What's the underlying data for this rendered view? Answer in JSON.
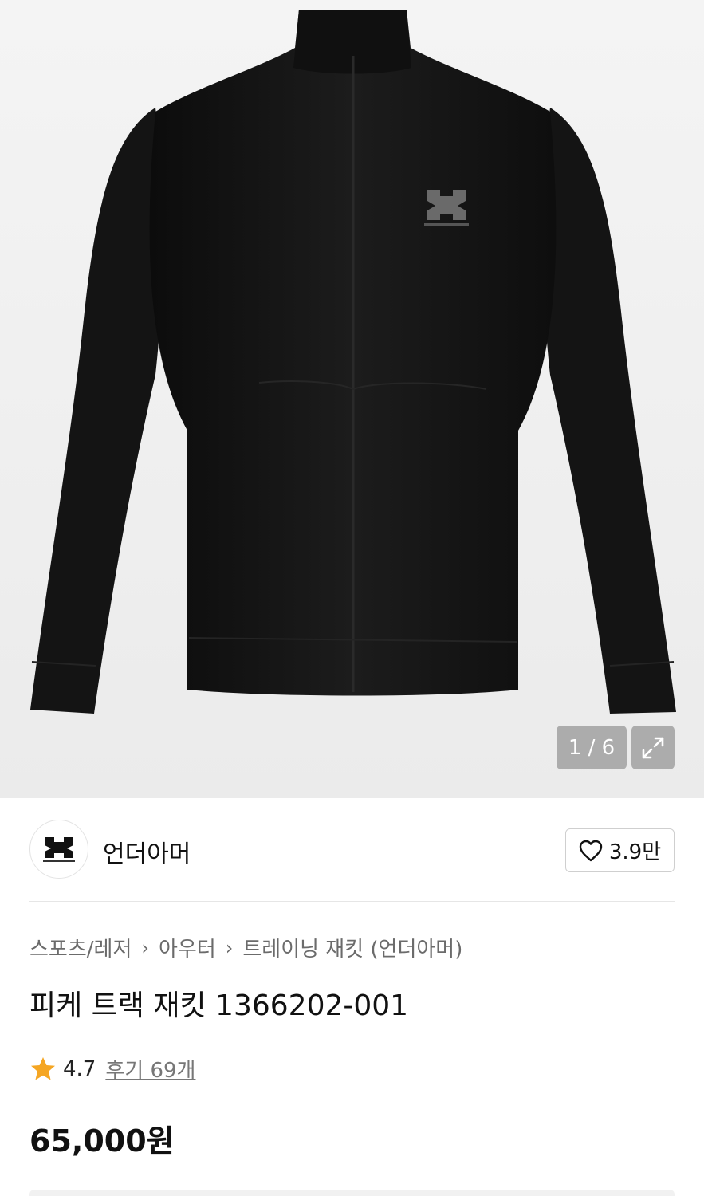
{
  "gallery": {
    "counter": "1 / 6",
    "current_index": 1,
    "total_images": 6,
    "product_image": "black track jacket",
    "expand_icon": "expand-icon"
  },
  "brand": {
    "name": "언더아머",
    "logo_icon": "under-armour-logo",
    "likes": "3.9만",
    "like_icon": "heart-outline-icon"
  },
  "breadcrumb": [
    "스포츠/레저",
    "아우터",
    "트레이닝 재킷 (언더아머)"
  ],
  "product": {
    "title": "피케 트랙 재킷 1366202-001",
    "rating": "4.7",
    "rating_icon": "star-icon",
    "reviews": "후기 69개",
    "price": "65,000원"
  },
  "colors": {
    "star": "#f5a623",
    "text": "#111111",
    "muted": "#6b6b6b"
  }
}
